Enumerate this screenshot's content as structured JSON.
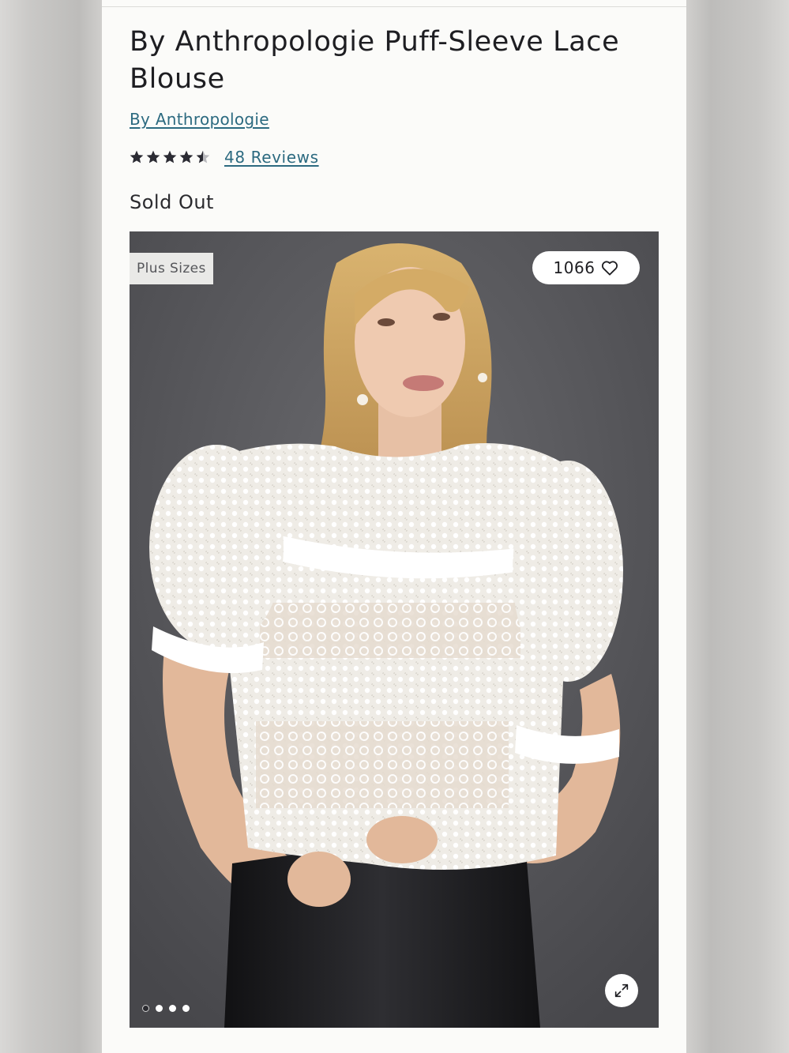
{
  "product": {
    "title": "By Anthropologie Puff-Sleeve Lace Blouse",
    "brand": "By Anthropologie",
    "rating": 4.5,
    "rating_max": 5,
    "reviews_label": "48 Reviews",
    "stock_status": "Sold Out"
  },
  "gallery": {
    "badge": "Plus Sizes",
    "favorites_count": "1066",
    "slide_count": 4,
    "active_slide": 1
  },
  "icons": {
    "star": "star-icon",
    "heart": "heart-outline-icon",
    "expand": "expand-arrows-icon"
  },
  "colors": {
    "link": "#2c6a80",
    "text": "#1e1e22",
    "star": "#2b2b33",
    "photo_backdrop": "#5a5a5e"
  }
}
